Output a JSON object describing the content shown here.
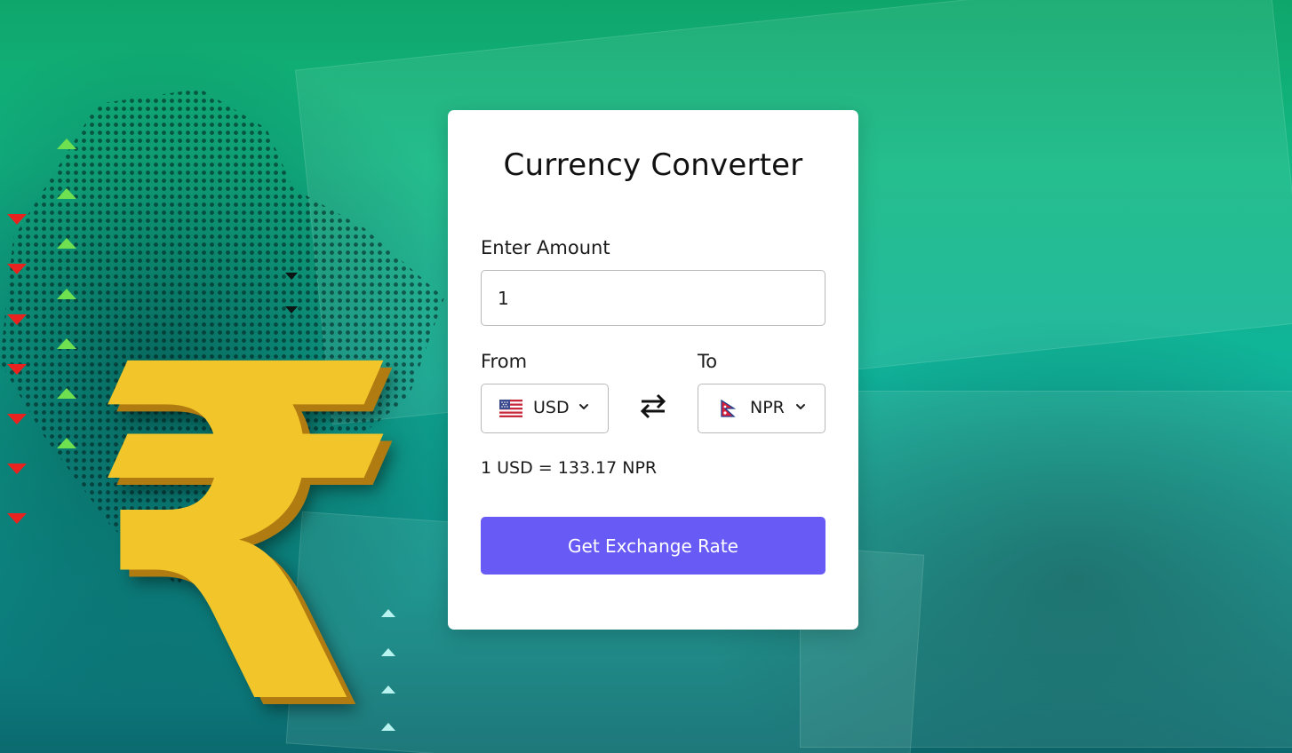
{
  "converter": {
    "title": "Currency Converter",
    "amount_label": "Enter Amount",
    "amount_value": "1",
    "from_label": "From",
    "to_label": "To",
    "from_currency": "USD",
    "to_currency": "NPR",
    "rate_text": "1 USD = 133.17 NPR",
    "button_label": "Get Exchange Rate"
  },
  "icons": {
    "from_flag": "us-flag-icon",
    "to_flag": "nepal-flag-icon",
    "chevron": "chevron-down-icon",
    "swap": "swap-arrows-icon"
  },
  "colors": {
    "button": "#675af5",
    "card": "#ffffff",
    "background_top": "#12b884",
    "background_bottom": "#0b6a6f",
    "rupee_symbol": "#f2c62a"
  }
}
